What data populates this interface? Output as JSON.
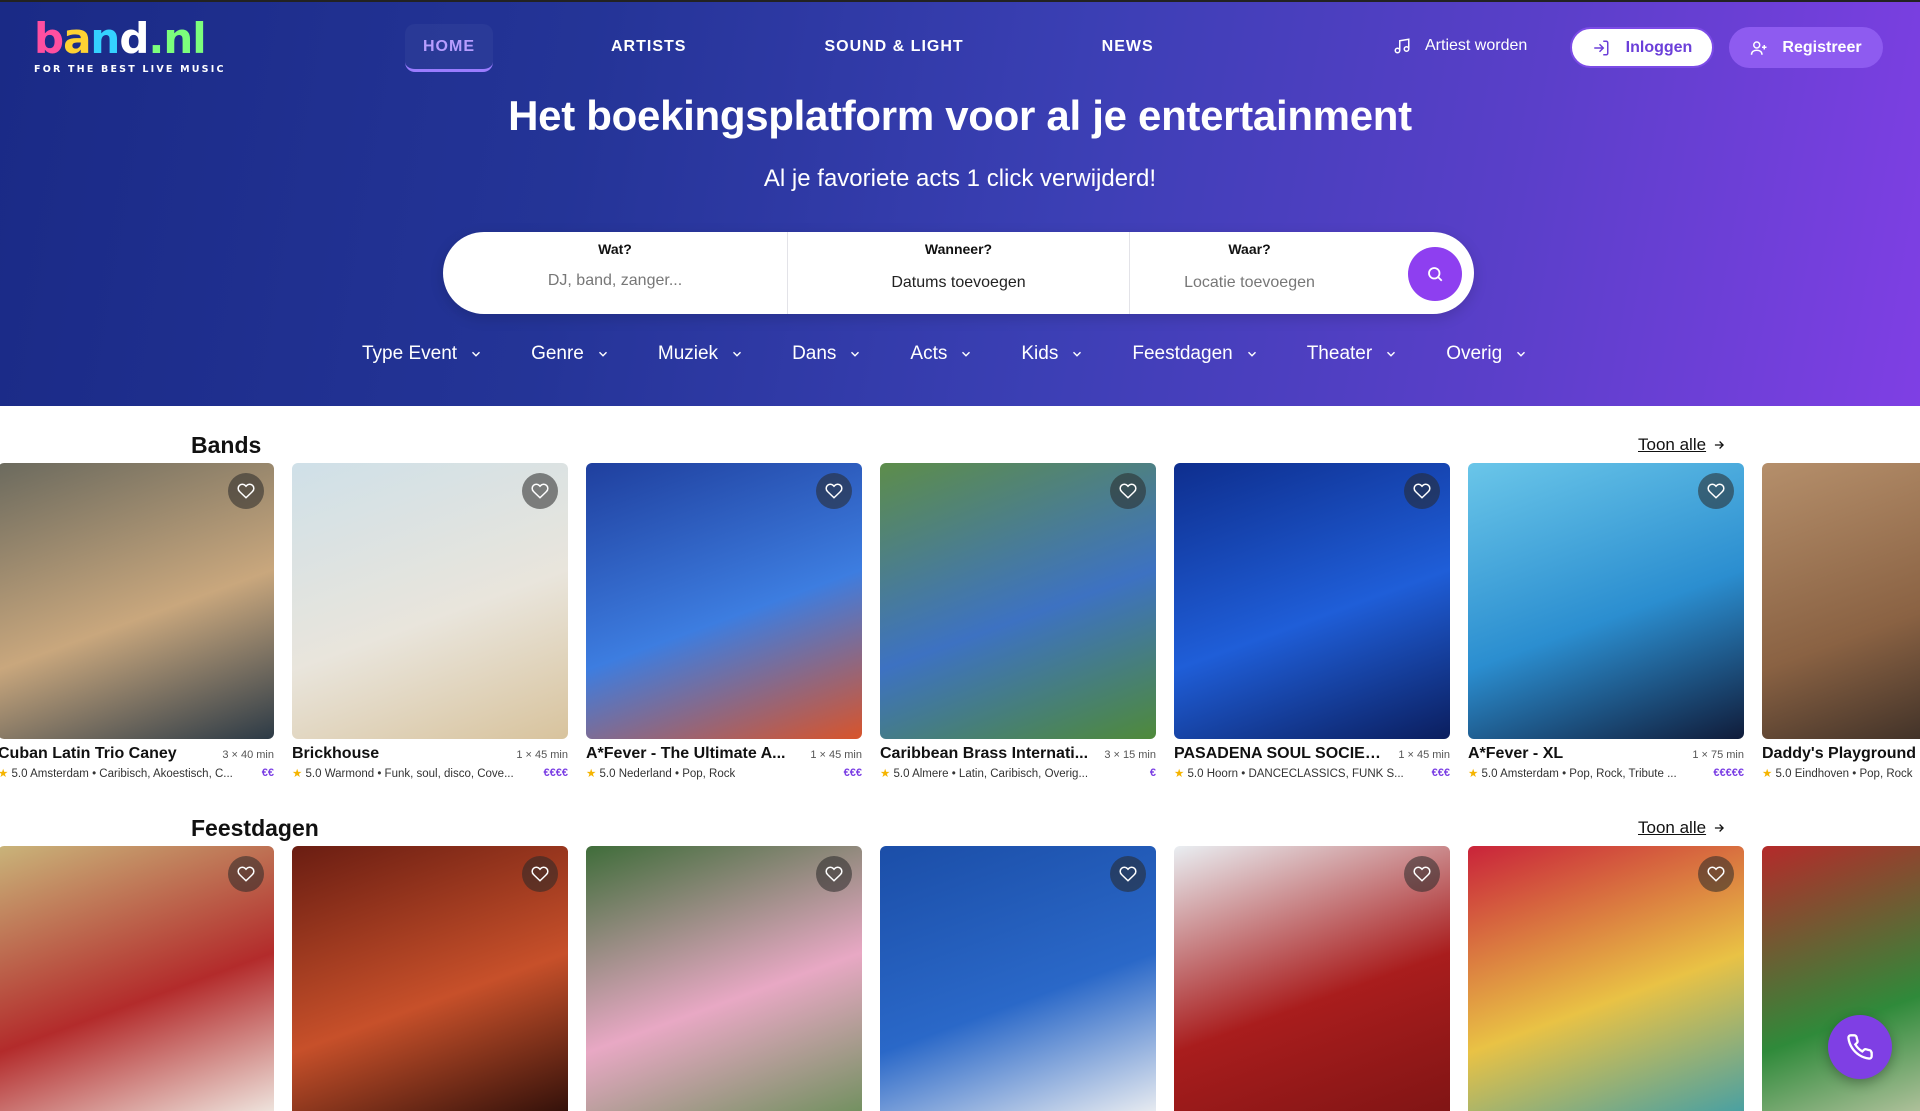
{
  "logo": {
    "parts": [
      "b",
      "a",
      "n",
      "d",
      ".nl"
    ],
    "tagline": "FOR THE BEST LIVE MUSIC"
  },
  "nav": {
    "items": [
      "HOME",
      "ARTISTS",
      "SOUND & LIGHT",
      "NEWS"
    ],
    "active": "HOME"
  },
  "header": {
    "artist_link": "Artiest worden",
    "login": "Inloggen",
    "register": "Registreer"
  },
  "hero": {
    "title": "Het boekingsplatform voor al je entertainment",
    "subtitle": "Al je favoriete acts 1 click verwijderd!"
  },
  "search": {
    "what_label": "Wat?",
    "what_placeholder": "DJ, band, zanger...",
    "when_label": "Wanneer?",
    "when_value": "Datums toevoegen",
    "where_label": "Waar?",
    "where_value": "Locatie toevoegen"
  },
  "categories": [
    "Type Event",
    "Genre",
    "Muziek",
    "Dans",
    "Acts",
    "Kids",
    "Feestdagen",
    "Theater",
    "Overig"
  ],
  "sections": [
    {
      "title": "Bands",
      "see_all": "Toon alle",
      "cards": [
        {
          "name": "Cuban Latin Trio Caney",
          "duration": "3 × 40 min",
          "rating": "5.0",
          "meta": "Amsterdam • Caribisch, Akoestisch, C...",
          "price": "€€",
          "colors": [
            "#6b6a5e",
            "#c9a77d",
            "#2c3a46"
          ]
        },
        {
          "name": "Brickhouse",
          "duration": "1 × 45 min",
          "rating": "5.0",
          "meta": "Warmond • Funk, soul, disco, Cove...",
          "price": "€€€€",
          "colors": [
            "#cfe0e8",
            "#e9e5dc",
            "#d8c39d"
          ]
        },
        {
          "name": "A*Fever - The Ultimate A...",
          "duration": "1 × 45 min",
          "rating": "5.0",
          "meta": "Nederland • Pop, Rock",
          "price": "€€€",
          "colors": [
            "#1f3f9e",
            "#3d7de0",
            "#d8542b"
          ]
        },
        {
          "name": "Caribbean Brass Internati...",
          "duration": "3 × 15 min",
          "rating": "5.0",
          "meta": "Almere • Latin, Caribisch, Overig...",
          "price": "€",
          "colors": [
            "#5d8d4a",
            "#3d72c2",
            "#4f8a3a"
          ]
        },
        {
          "name": "PASADENA SOUL SOCIETY",
          "duration": "1 × 45 min",
          "rating": "5.0",
          "meta": "Hoorn • DANCECLASSICS, FUNK S...",
          "price": "€€€",
          "colors": [
            "#0e2e8e",
            "#1f5ed8",
            "#0b1e5e"
          ]
        },
        {
          "name": "A*Fever - XL",
          "duration": "1 × 75 min",
          "rating": "5.0",
          "meta": "Amsterdam • Pop, Rock, Tribute ...",
          "price": "€€€€€",
          "colors": [
            "#6ac6e9",
            "#2b8ed0",
            "#101c3a"
          ]
        },
        {
          "name": "Daddy's Playground",
          "duration": "",
          "rating": "5.0",
          "meta": "Eindhoven • Pop, Rock",
          "price": "",
          "colors": [
            "#b58f6b",
            "#8a6243",
            "#2a2320"
          ]
        }
      ]
    },
    {
      "title": "Feestdagen",
      "see_all": "Toon alle",
      "cards": [
        {
          "colors": [
            "#c9b47a",
            "#b32b2b",
            "#f2efe8"
          ]
        },
        {
          "colors": [
            "#6a1d12",
            "#c7502a",
            "#2a0d08"
          ]
        },
        {
          "colors": [
            "#3f6d3a",
            "#e8a8c4",
            "#6b8f5a"
          ]
        },
        {
          "colors": [
            "#1b4ea8",
            "#2a68c8",
            "#f3f3f3"
          ]
        },
        {
          "colors": [
            "#e9eef2",
            "#a91d1d",
            "#7e1414"
          ]
        },
        {
          "colors": [
            "#c9233a",
            "#e9c245",
            "#3f9ea8"
          ]
        },
        {
          "colors": [
            "#b42a2a",
            "#2f8a3a",
            "#e9d9c7"
          ]
        }
      ]
    }
  ]
}
